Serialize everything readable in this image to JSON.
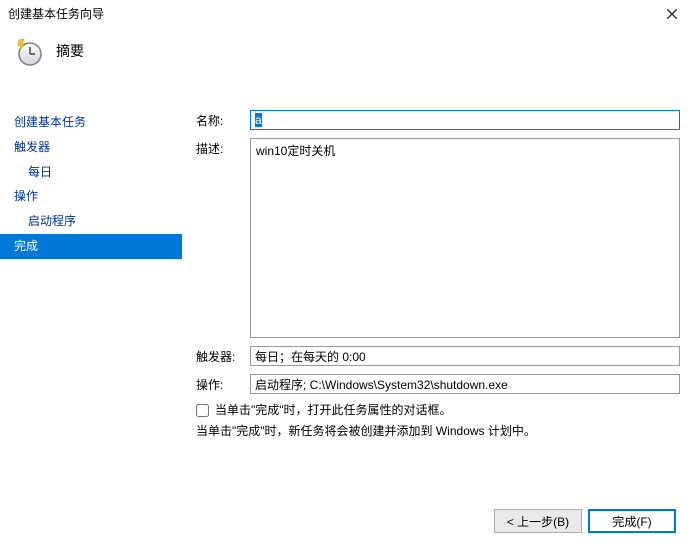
{
  "window": {
    "title": "创建基本任务向导"
  },
  "header": {
    "title": "摘要"
  },
  "sidebar": {
    "items": [
      {
        "label": "创建基本任务"
      },
      {
        "label": "触发器"
      },
      {
        "label": "每日"
      },
      {
        "label": "操作"
      },
      {
        "label": "启动程序"
      },
      {
        "label": "完成"
      }
    ]
  },
  "form": {
    "name_label": "名称:",
    "name_value": "a",
    "desc_label": "描述:",
    "desc_value": "win10定时关机",
    "trigger_label": "触发器:",
    "trigger_value": "每日；在每天的 0:00",
    "action_label": "操作:",
    "action_value": "启动程序; C:\\Windows\\System32\\shutdown.exe",
    "check_label": "当单击\"完成\"时，打开此任务属性的对话框。",
    "info_text": "当单击\"完成\"时，新任务将会被创建并添加到 Windows 计划中。"
  },
  "buttons": {
    "back": "< 上一步(B)",
    "finish": "完成(F)"
  }
}
